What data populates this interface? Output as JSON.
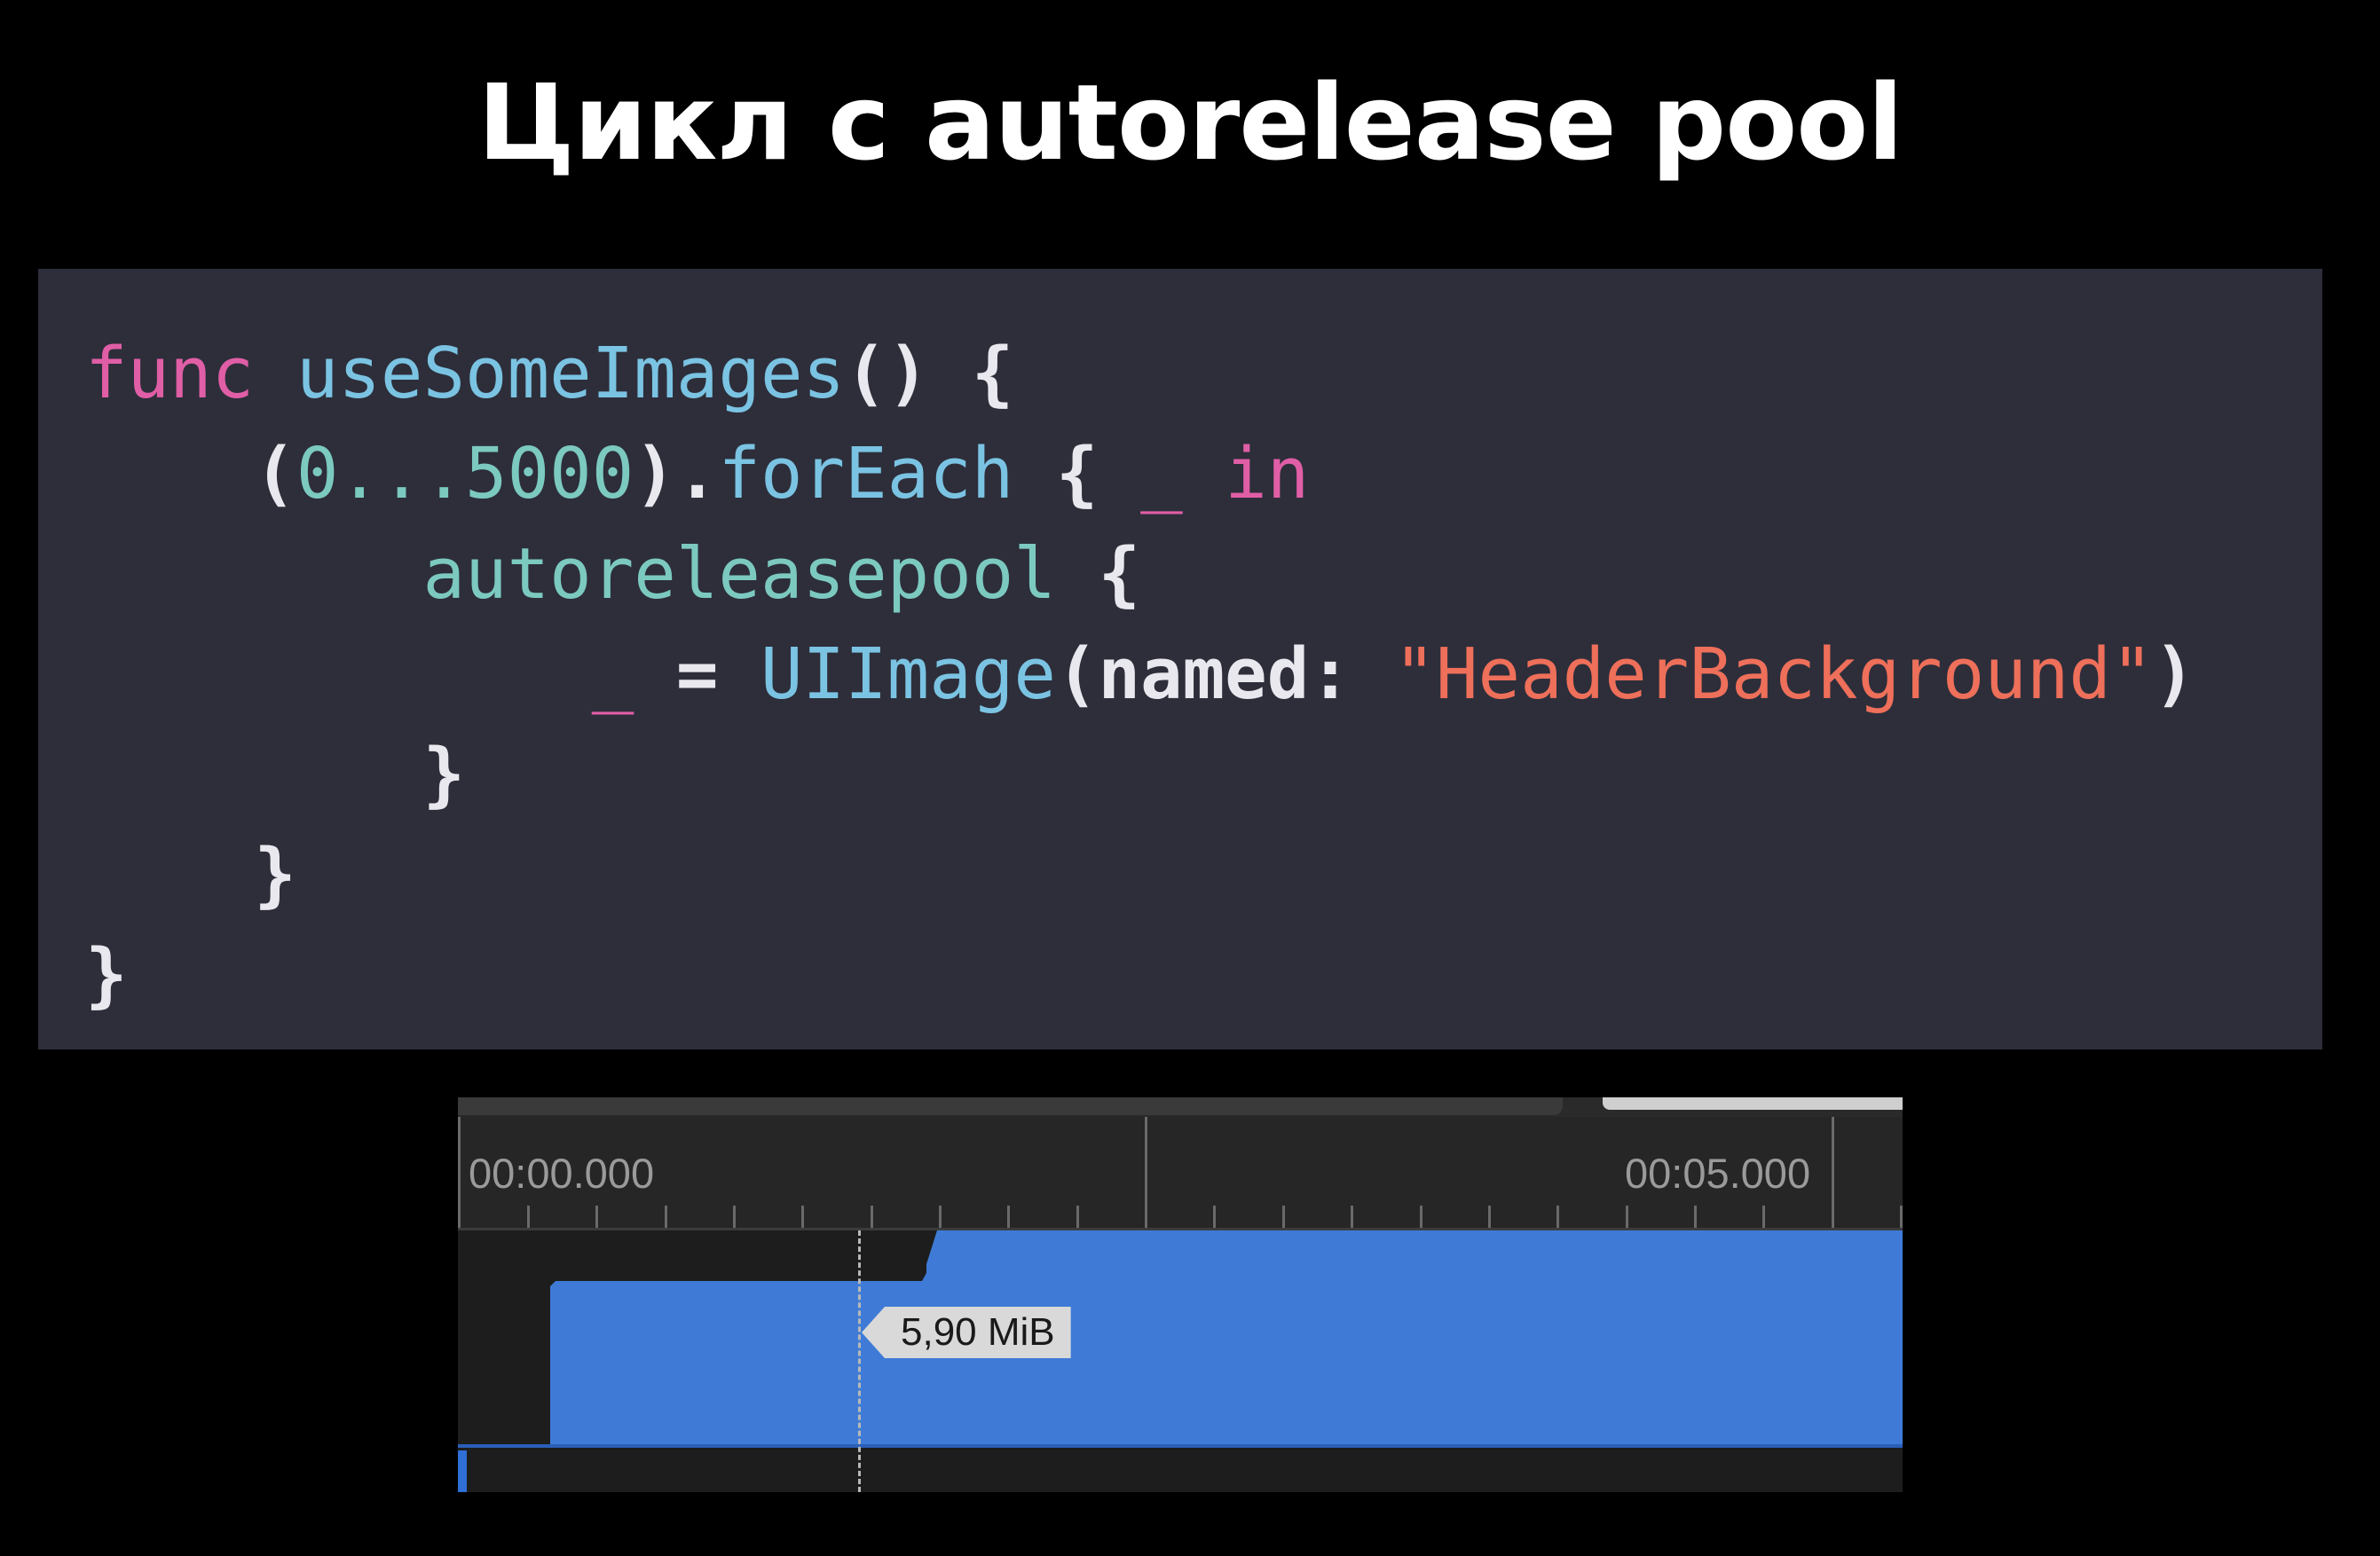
{
  "slide": {
    "title": "Цикл с autorelease pool"
  },
  "code": {
    "language": "swift",
    "lines": [
      [
        {
          "t": "func",
          "k": "kw"
        },
        {
          "t": " ",
          "k": "plain"
        },
        {
          "t": "useSomeImages",
          "k": "fn"
        },
        {
          "t": "() {",
          "k": "punct"
        }
      ],
      [
        {
          "t": "    (",
          "k": "punct"
        },
        {
          "t": "0...5000",
          "k": "num"
        },
        {
          "t": ").",
          "k": "punct"
        },
        {
          "t": "forEach",
          "k": "fn"
        },
        {
          "t": " { ",
          "k": "punct"
        },
        {
          "t": "_",
          "k": "kw"
        },
        {
          "t": " ",
          "k": "plain"
        },
        {
          "t": "in",
          "k": "kw"
        }
      ],
      [
        {
          "t": "        ",
          "k": "plain"
        },
        {
          "t": "autoreleasepool",
          "k": "num"
        },
        {
          "t": " {",
          "k": "punct"
        }
      ],
      [
        {
          "t": "            ",
          "k": "plain"
        },
        {
          "t": "_",
          "k": "kw"
        },
        {
          "t": " = ",
          "k": "punct"
        },
        {
          "t": "UIImage",
          "k": "fn"
        },
        {
          "t": "(named: ",
          "k": "punct"
        },
        {
          "t": "\"HeaderBackground\"",
          "k": "str"
        },
        {
          "t": ")",
          "k": "punct"
        }
      ],
      [
        {
          "t": "        }",
          "k": "punct"
        }
      ],
      [
        {
          "t": "    }",
          "k": "punct"
        }
      ],
      [
        {
          "t": "}",
          "k": "punct"
        }
      ]
    ]
  },
  "timeline": {
    "start_label": "00:00.000",
    "end_label": "00:05.000",
    "value_label": "5,90 MiB",
    "fill_color": "#3f7bd6"
  }
}
